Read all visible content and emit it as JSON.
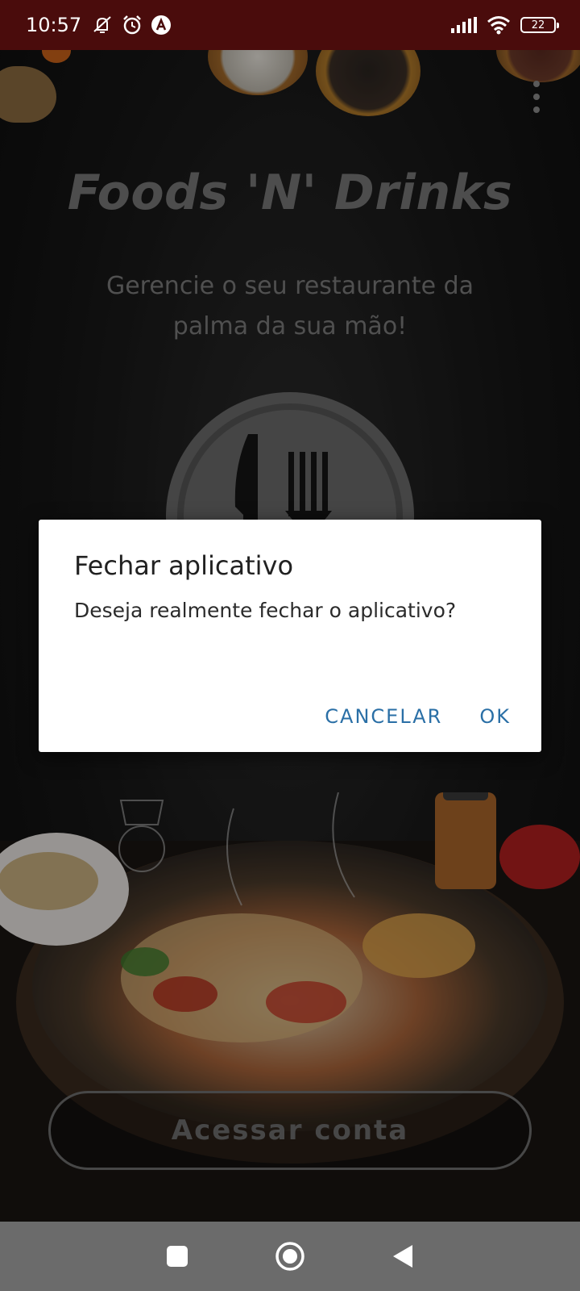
{
  "status_bar": {
    "time": "10:57",
    "battery": "22",
    "icons": [
      "mute-icon",
      "alarm-icon",
      "app-notification-icon",
      "signal-icon",
      "wifi-icon",
      "battery-icon"
    ]
  },
  "app": {
    "title": "Foods 'N' Drinks",
    "subtitle": "Gerencie o seu restaurante da palma da sua mão!",
    "access_button": "Acessar conta",
    "menu_icon": "more-vert-icon"
  },
  "dialog": {
    "title": "Fechar aplicativo",
    "message": "Deseja realmente fechar o aplicativo?",
    "cancel_label": "CANCELAR",
    "ok_label": "OK"
  },
  "nav_bar": {
    "icons": [
      "recents-icon",
      "home-icon",
      "back-icon"
    ]
  },
  "colors": {
    "status_bar": "#4a0c0c",
    "dialog_button": "#2a6fa6",
    "nav_bar": "#6b6b6b"
  }
}
